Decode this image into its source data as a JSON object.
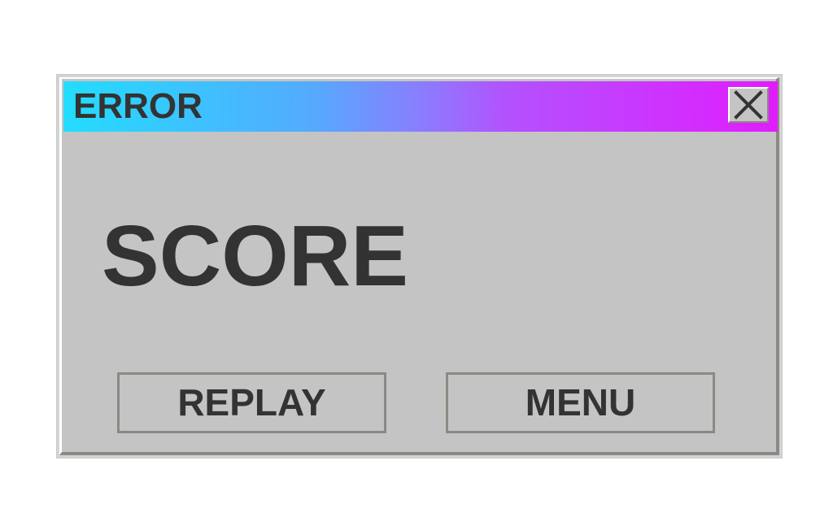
{
  "dialog": {
    "title": "ERROR",
    "close_icon": "close-icon",
    "score_label": "SCORE",
    "buttons": {
      "replay": "REPLAY",
      "menu": "MENU"
    }
  },
  "colors": {
    "title_gradient_start": "#23dcfe",
    "title_gradient_end": "#e11cfe",
    "dialog_bg": "#c4c4c4",
    "text": "#333333",
    "border_dark": "#8a8a84"
  }
}
